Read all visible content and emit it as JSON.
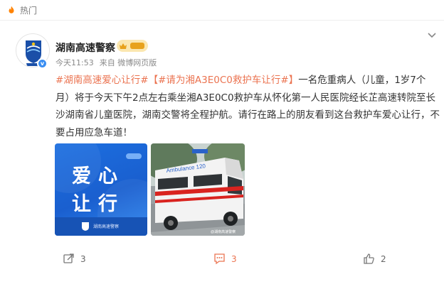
{
  "header": {
    "hot_label": "热门"
  },
  "user": {
    "name": "湖南高速警察",
    "time": "今天11:53",
    "source_prefix": "来自",
    "source": "微博网页版",
    "verified_mark": "v"
  },
  "post": {
    "tags": [
      "#湖南高速爱心让行#",
      "【#请为湘A3E0C0救护车让行#】"
    ],
    "body": "一名危重病人（儿童，1岁7个月）将于今天下午2点左右乘坐湘A3E0C0救护车从怀化第一人民医院经长芷高速转院至长沙湖南省儿童医院，湖南交警将全程护航。请行在路上的朋友看到这台救护车爱心让行，不要占用应急车道！"
  },
  "images": [
    {
      "line1": "爱心",
      "line2": "让行",
      "caption": "湖南高速警察"
    },
    {
      "ambulance_text": "Ambulance 120",
      "watermark": "@湖南高速警察"
    }
  ],
  "actions": {
    "repost": "3",
    "comment": "3",
    "like": "2"
  },
  "colors": {
    "accent": "#eb7350",
    "verified": "#3a8ef2",
    "poster_blue": "#1c6fe0"
  },
  "icons": {
    "hot": "fire-icon",
    "repost": "repost-icon",
    "comment": "comment-icon",
    "like": "thumbs-up-icon",
    "menu": "chevron-down-icon"
  }
}
